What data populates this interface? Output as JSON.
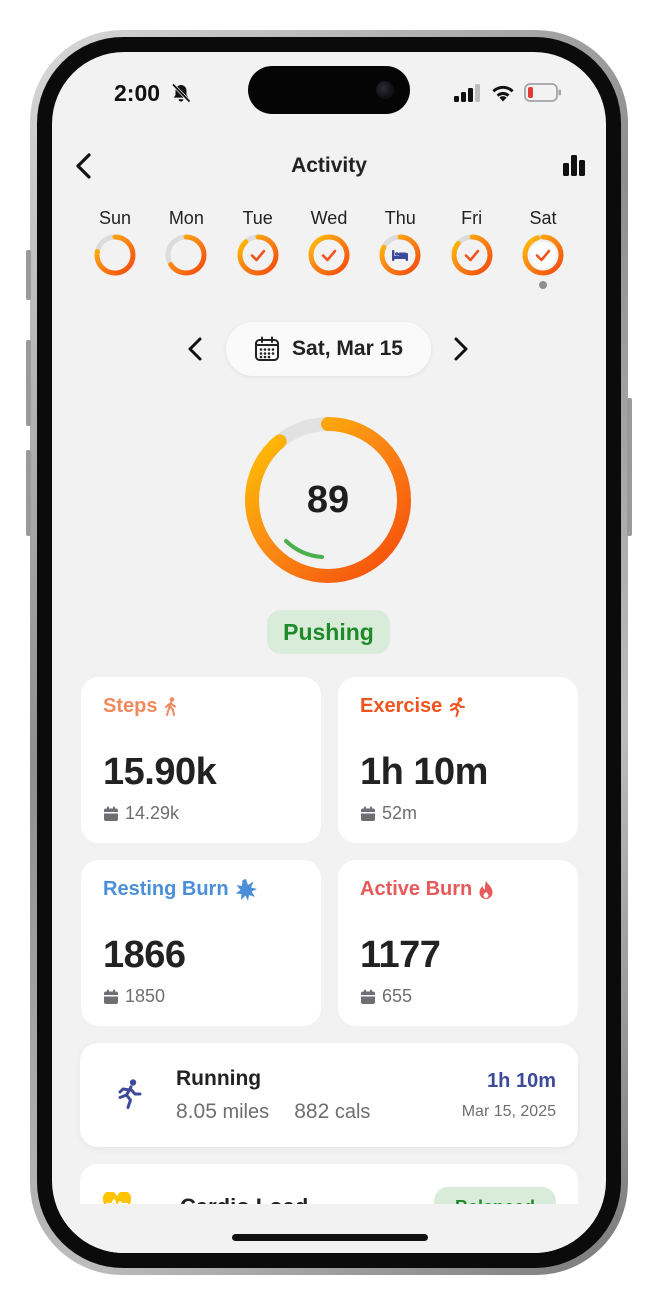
{
  "status_bar": {
    "time": "2:00",
    "icons": [
      "bell-slash-icon",
      "cellular-signal-icon",
      "wifi-icon",
      "battery-low-icon"
    ]
  },
  "nav": {
    "title": "Activity",
    "back_icon": "chevron-left-icon",
    "chart_icon": "bar-chart-icon"
  },
  "week": {
    "days": [
      {
        "label": "Sun",
        "progress": 0.78,
        "state": "none",
        "selected": false
      },
      {
        "label": "Mon",
        "progress": 0.66,
        "state": "none",
        "selected": false
      },
      {
        "label": "Tue",
        "progress": 0.88,
        "state": "check",
        "selected": false
      },
      {
        "label": "Wed",
        "progress": 1.0,
        "state": "check",
        "selected": false
      },
      {
        "label": "Thu",
        "progress": 0.82,
        "state": "bed",
        "selected": false
      },
      {
        "label": "Fri",
        "progress": 0.86,
        "state": "check",
        "selected": false
      },
      {
        "label": "Sat",
        "progress": 0.95,
        "state": "check",
        "selected": true
      }
    ]
  },
  "date_picker": {
    "label": "Sat, Mar 15",
    "prev_icon": "chevron-left-icon",
    "next_icon": "chevron-right-icon",
    "calendar_icon": "calendar-icon"
  },
  "score": {
    "value": "89",
    "progress": 0.89,
    "status": "Pushing"
  },
  "cards": {
    "steps": {
      "title": "Steps",
      "value": "15.90k",
      "sub": "14.29k",
      "color": "#F08A5D",
      "icon": "walking-icon"
    },
    "exercise": {
      "title": "Exercise",
      "value": "1h 10m",
      "sub": "52m",
      "color": "#F0541E",
      "icon": "running-icon"
    },
    "resting": {
      "title": "Resting Burn",
      "value": "1866",
      "sub": "1850",
      "color": "#4A8FD8",
      "icon": "starburst-icon"
    },
    "active": {
      "title": "Active Burn",
      "value": "1177",
      "sub": "655",
      "color": "#E85A5A",
      "icon": "flame-icon"
    }
  },
  "workout": {
    "title": "Running",
    "distance": "8.05",
    "distance_unit": "miles",
    "calories": "882",
    "calories_unit": "cals",
    "duration": "1h 10m",
    "date": "Mar 15, 2025",
    "icon": "running-icon"
  },
  "cardio": {
    "title": "Cardio Load",
    "badge": "Balanced",
    "icon": "heart-icon"
  }
}
